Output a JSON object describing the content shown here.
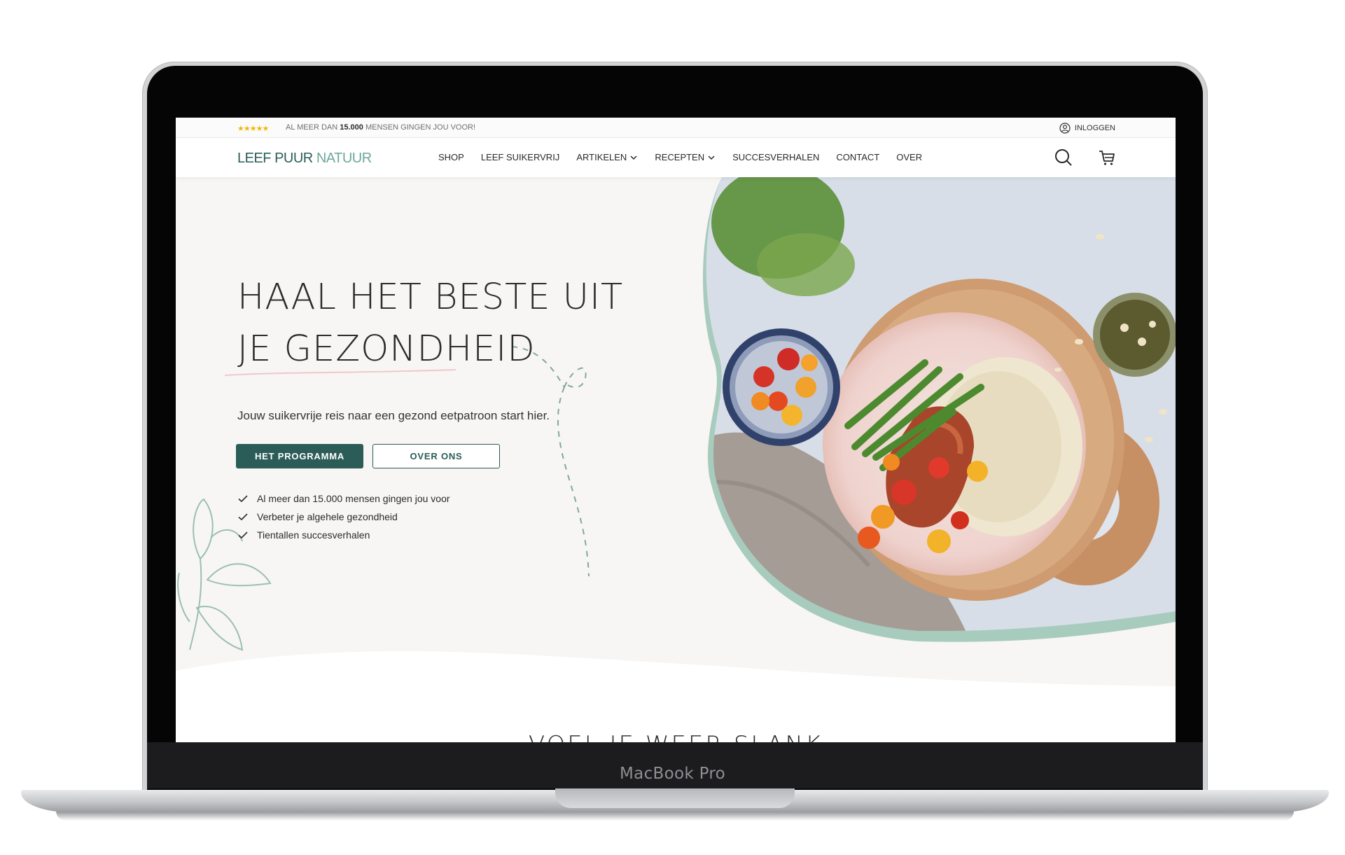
{
  "device": {
    "label": "MacBook Pro"
  },
  "topbar": {
    "stars": "★★★★★",
    "text_before": "AL MEER DAN ",
    "count": "15.000",
    "text_after": " MENSEN GINGEN JOU VOOR!",
    "login_label": "INLOGGEN"
  },
  "nav": {
    "logo_part1": "LEEF PUUR ",
    "logo_part2": "NATUUR",
    "items": [
      {
        "label": "SHOP"
      },
      {
        "label": "LEEF SUIKERVRIJ"
      },
      {
        "label": "ARTIKELEN"
      },
      {
        "label": "RECEPTEN"
      },
      {
        "label": "SUCCESVERHALEN"
      },
      {
        "label": "CONTACT"
      },
      {
        "label": "OVER"
      }
    ]
  },
  "hero": {
    "title_line1": "HAAL HET BESTE UIT",
    "title_line2": "JE GEZONDHEID",
    "subtitle": "Jouw suikervrije reis naar een gezond eetpatroon start hier.",
    "primary_button": "HET PROGRAMMA",
    "secondary_button": "OVER ONS",
    "checklist": [
      "Al meer dan 15.000 mensen gingen jou voor",
      "Verbeter je algehele gezondheid",
      "Tientallen succesverhalen"
    ]
  },
  "next_section": {
    "title_peek": "VOEL JE WEER SLANK"
  },
  "colors": {
    "brand": "#2c5c58",
    "accent": "#6ea89a",
    "hero_bg": "#f8f6f4",
    "stars": "#f2b705"
  }
}
